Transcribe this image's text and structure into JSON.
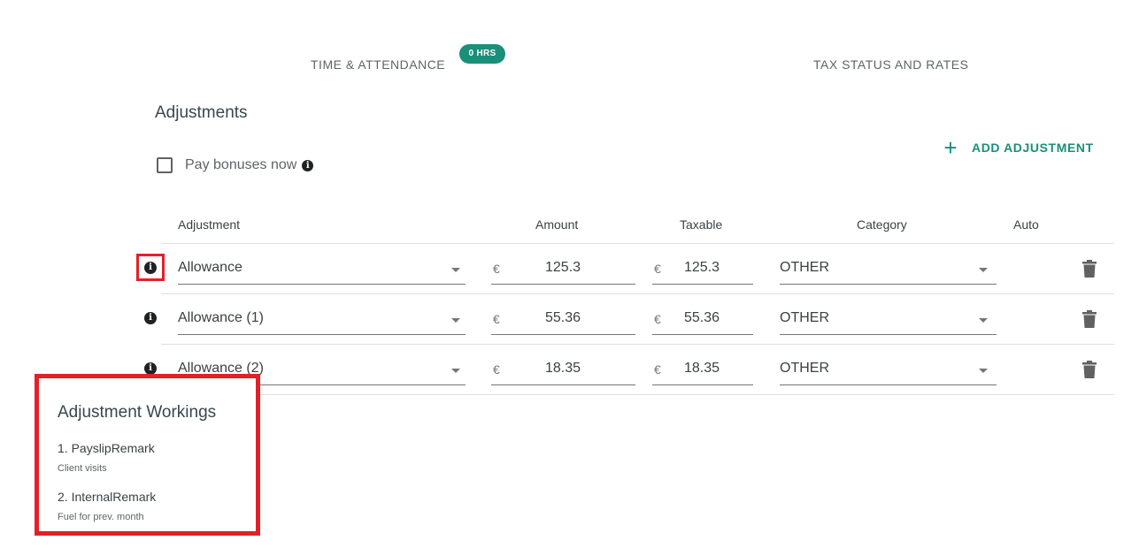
{
  "tabs": {
    "time_attendance": "TIME & ATTENDANCE",
    "hours_badge": "0 HRS",
    "tax_status": "TAX STATUS AND RATES"
  },
  "section": {
    "title": "Adjustments",
    "add_label": "ADD ADJUSTMENT",
    "pay_bonuses_label": "Pay bonuses now"
  },
  "table": {
    "headers": {
      "adjustment": "Adjustment",
      "amount": "Amount",
      "taxable": "Taxable",
      "category": "Category",
      "auto": "Auto"
    },
    "currency": "€",
    "rows": [
      {
        "adjustment": "Allowance",
        "amount": "125.3",
        "taxable": "125.3",
        "category": "OTHER"
      },
      {
        "adjustment": "Allowance (1)",
        "amount": "55.36",
        "taxable": "55.36",
        "category": "OTHER"
      },
      {
        "adjustment": "Allowance (2)",
        "amount": "18.35",
        "taxable": "18.35",
        "category": "OTHER"
      }
    ]
  },
  "popup": {
    "title": "Adjustment Workings",
    "items": [
      {
        "label": "1. PayslipRemark",
        "value": "Client visits"
      },
      {
        "label": "2. InternalRemark",
        "value": "Fuel for prev. month"
      }
    ]
  },
  "colors": {
    "accent": "#1a8f7a",
    "highlight": "#e32027"
  },
  "icons": {
    "info": "info-icon",
    "delete": "trash-icon",
    "dropdown": "caret-down-icon",
    "add": "plus-icon"
  }
}
